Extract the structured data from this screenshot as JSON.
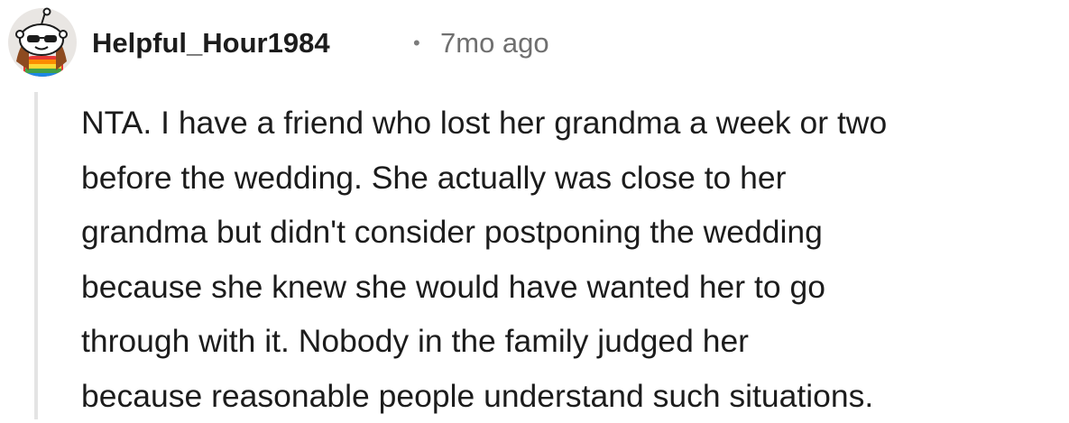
{
  "comment": {
    "username": "Helpful_Hour1984",
    "separator": "•",
    "timestamp": "7mo ago",
    "body_lines": [
      "NTA. I have a friend who lost her grandma a week or two",
      "before the wedding. She actually was close to her",
      "grandma but didn't consider postponing the wedding",
      "because she knew she would have wanted her to go",
      "through with it. Nobody in the family judged her",
      "because reasonable people understand such situations."
    ],
    "avatar_icon": "snoo-avatar-sunglasses-rainbow-icon"
  },
  "colors": {
    "text_primary": "#1c1c1c",
    "text_secondary": "#6f6f6f",
    "thread_line": "#e4e4e4",
    "background": "#ffffff"
  }
}
